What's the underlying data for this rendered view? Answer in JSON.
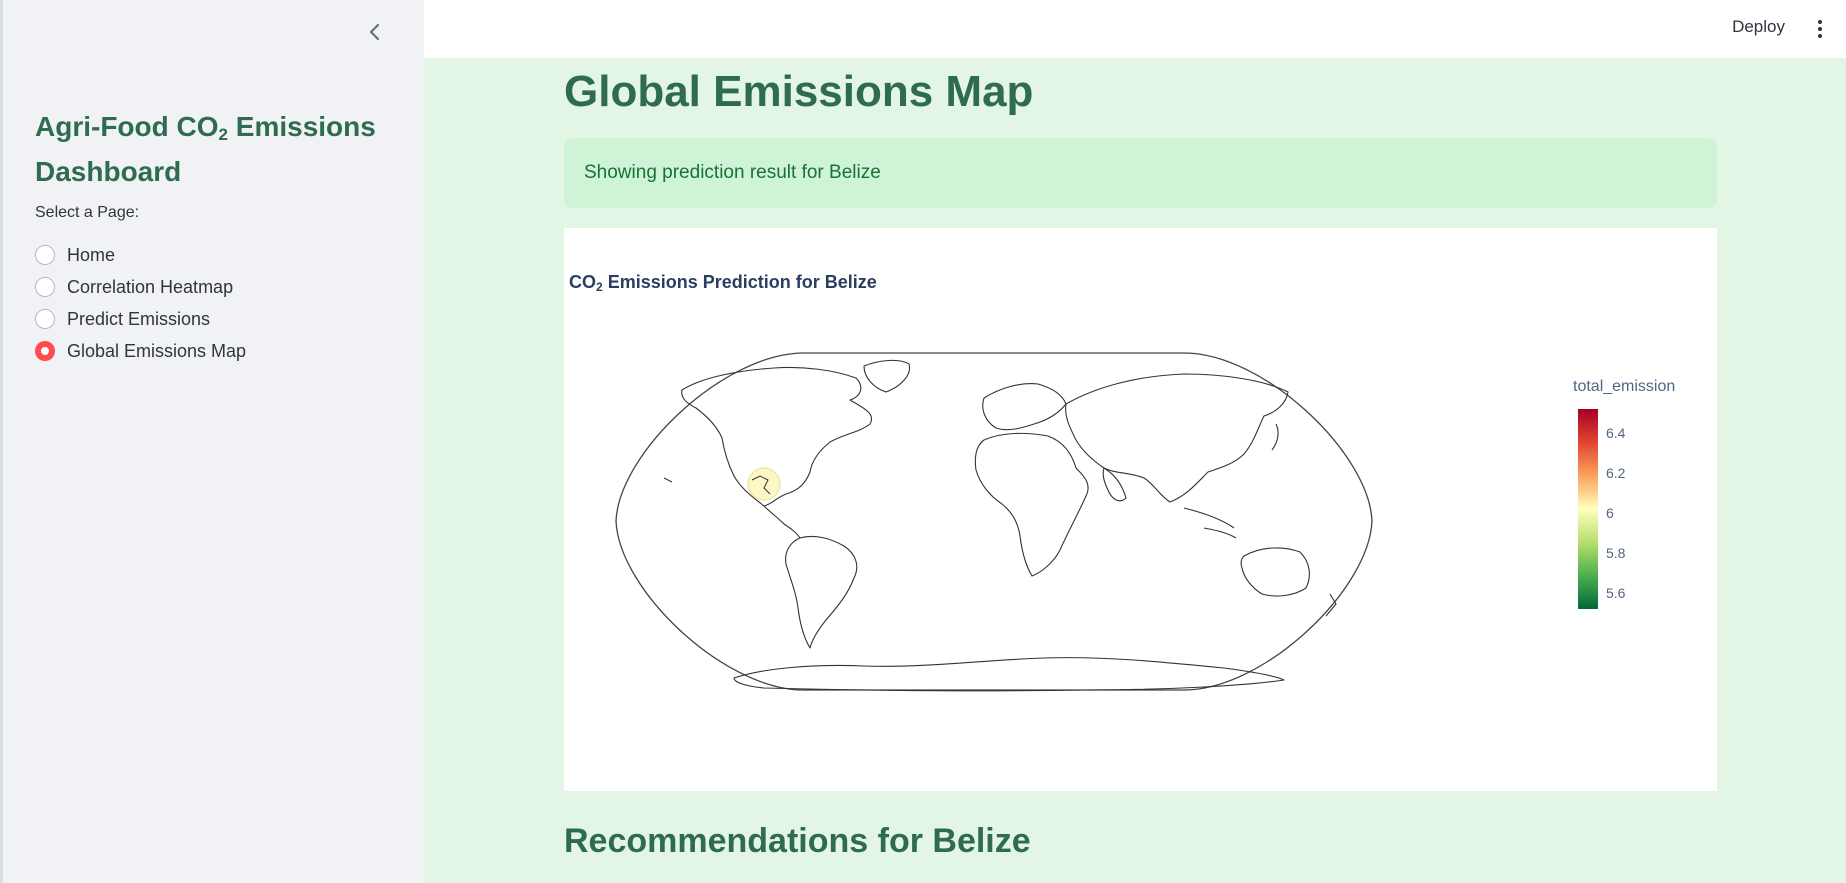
{
  "sidebar": {
    "collapse_icon": "chevron-left-icon",
    "title_prefix": "Agri-Food CO",
    "title_sub": "2",
    "title_suffix": " Emissions Dashboard",
    "select_label": "Select a Page:",
    "pages": [
      {
        "label": "Home",
        "selected": false
      },
      {
        "label": "Correlation Heatmap",
        "selected": false
      },
      {
        "label": "Predict Emissions",
        "selected": false
      },
      {
        "label": "Global Emissions Map",
        "selected": true
      }
    ]
  },
  "topbar": {
    "deploy_label": "Deploy",
    "menu_icon": "more-vertical-icon"
  },
  "main": {
    "page_title": "Global Emissions Map",
    "alert_text": "Showing prediction result for Belize",
    "section_title": "Recommendations for Belize"
  },
  "map": {
    "title_prefix": "CO",
    "title_sub": "2",
    "title_suffix": " Emissions Prediction for Belize",
    "highlighted_country": "Belize",
    "highlight_color": "#fbf7c4",
    "colorbar_title": "total_emission",
    "colorbar_ticks": [
      "6.4",
      "6.2",
      "6",
      "5.8",
      "5.6"
    ],
    "colorscale": [
      "#a50026",
      "#e0452f",
      "#fca35d",
      "#ffffbf",
      "#b5df6b",
      "#4daf4f",
      "#006837"
    ]
  }
}
